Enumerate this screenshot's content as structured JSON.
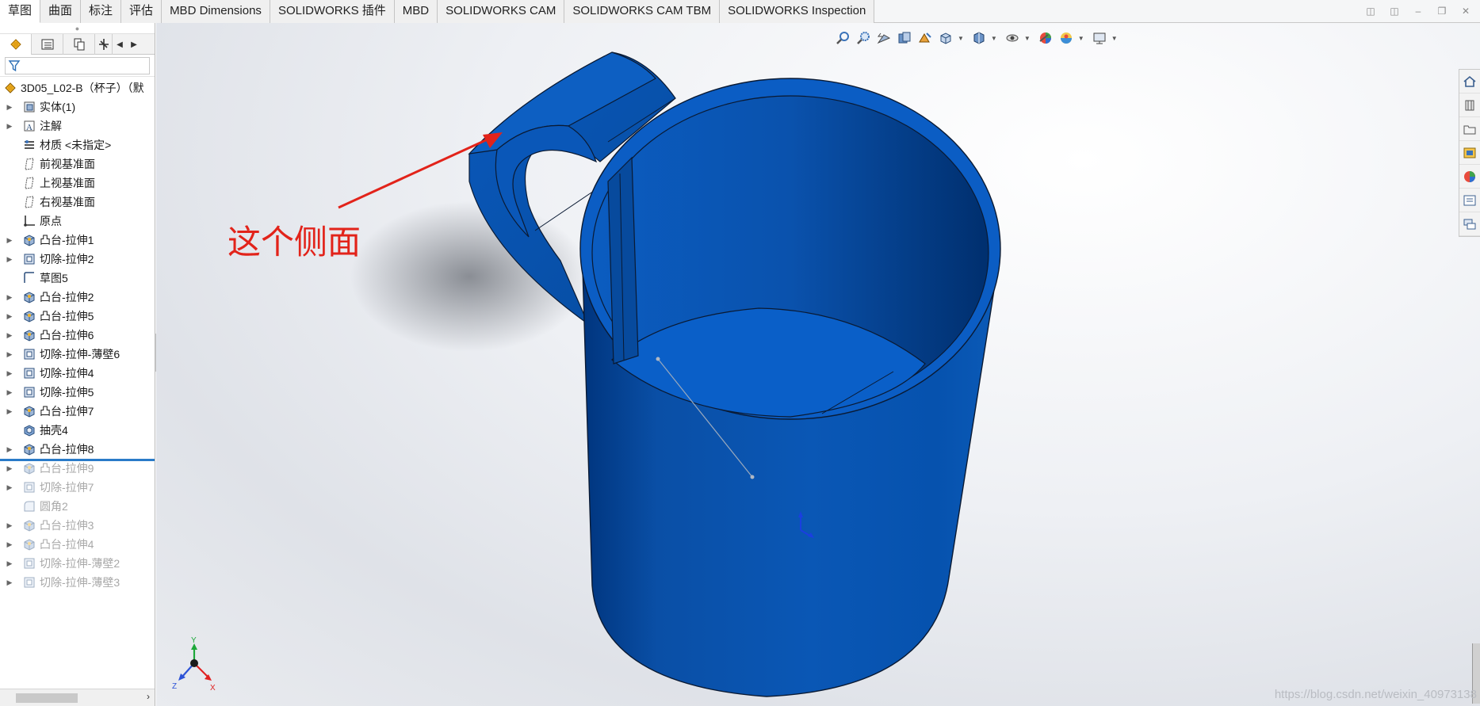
{
  "tabs": [
    {
      "label": "草图",
      "active": true
    },
    {
      "label": "曲面",
      "active": false
    },
    {
      "label": "标注",
      "active": false
    },
    {
      "label": "评估",
      "active": false
    },
    {
      "label": "MBD Dimensions",
      "active": false
    },
    {
      "label": "SOLIDWORKS 插件",
      "active": false
    },
    {
      "label": "MBD",
      "active": false
    },
    {
      "label": "SOLIDWORKS CAM",
      "active": false
    },
    {
      "label": "SOLIDWORKS CAM TBM",
      "active": false
    },
    {
      "label": "SOLIDWORKS Inspection",
      "active": false
    }
  ],
  "tree": {
    "root_label": "3D05_L02-B（杯子）（默",
    "items": [
      {
        "label": "实体(1)",
        "icon": "solid-bodies-icon",
        "expandable": true,
        "suppressed": false
      },
      {
        "label": "注解",
        "icon": "annotations-icon",
        "expandable": true,
        "suppressed": false
      },
      {
        "label": "材质 <未指定>",
        "icon": "material-icon",
        "expandable": false,
        "suppressed": false
      },
      {
        "label": "前视基准面",
        "icon": "plane-icon",
        "expandable": false,
        "suppressed": false
      },
      {
        "label": "上视基准面",
        "icon": "plane-icon",
        "expandable": false,
        "suppressed": false
      },
      {
        "label": "右视基准面",
        "icon": "plane-icon",
        "expandable": false,
        "suppressed": false
      },
      {
        "label": "原点",
        "icon": "origin-icon",
        "expandable": false,
        "suppressed": false
      },
      {
        "label": "凸台-拉伸1",
        "icon": "boss-extrude-icon",
        "expandable": true,
        "suppressed": false
      },
      {
        "label": "切除-拉伸2",
        "icon": "cut-extrude-icon",
        "expandable": true,
        "suppressed": false
      },
      {
        "label": "草图5",
        "icon": "sketch-icon",
        "expandable": false,
        "suppressed": false
      },
      {
        "label": "凸台-拉伸2",
        "icon": "boss-extrude-icon",
        "expandable": true,
        "suppressed": false
      },
      {
        "label": "凸台-拉伸5",
        "icon": "boss-extrude-icon",
        "expandable": true,
        "suppressed": false
      },
      {
        "label": "凸台-拉伸6",
        "icon": "boss-extrude-icon",
        "expandable": true,
        "suppressed": false
      },
      {
        "label": "切除-拉伸-薄壁6",
        "icon": "cut-extrude-icon",
        "expandable": true,
        "suppressed": false
      },
      {
        "label": "切除-拉伸4",
        "icon": "cut-extrude-icon",
        "expandable": true,
        "suppressed": false
      },
      {
        "label": "切除-拉伸5",
        "icon": "cut-extrude-icon",
        "expandable": true,
        "suppressed": false
      },
      {
        "label": "凸台-拉伸7",
        "icon": "boss-extrude-icon",
        "expandable": true,
        "suppressed": false
      },
      {
        "label": "抽壳4",
        "icon": "shell-icon",
        "expandable": false,
        "suppressed": false
      },
      {
        "label": "凸台-拉伸8",
        "icon": "boss-extrude-icon",
        "expandable": true,
        "suppressed": false
      },
      {
        "label": "凸台-拉伸9",
        "icon": "boss-extrude-icon",
        "expandable": true,
        "suppressed": true
      },
      {
        "label": "切除-拉伸7",
        "icon": "cut-extrude-icon",
        "expandable": true,
        "suppressed": true
      },
      {
        "label": "圆角2",
        "icon": "fillet-icon",
        "expandable": false,
        "suppressed": true
      },
      {
        "label": "凸台-拉伸3",
        "icon": "boss-extrude-icon",
        "expandable": true,
        "suppressed": true
      },
      {
        "label": "凸台-拉伸4",
        "icon": "boss-extrude-icon",
        "expandable": true,
        "suppressed": true
      },
      {
        "label": "切除-拉伸-薄壁2",
        "icon": "cut-extrude-icon",
        "expandable": true,
        "suppressed": true
      },
      {
        "label": "切除-拉伸-薄壁3",
        "icon": "cut-extrude-icon",
        "expandable": true,
        "suppressed": true
      }
    ]
  },
  "viewport": {
    "annotation_text": "这个侧面",
    "watermark": "https://blog.csdn.net/weixin_40973138",
    "model_color": "#0a52b0",
    "annotation_color": "#e2231a",
    "triad": {
      "x": "X",
      "y": "Y",
      "z": "Z"
    }
  }
}
